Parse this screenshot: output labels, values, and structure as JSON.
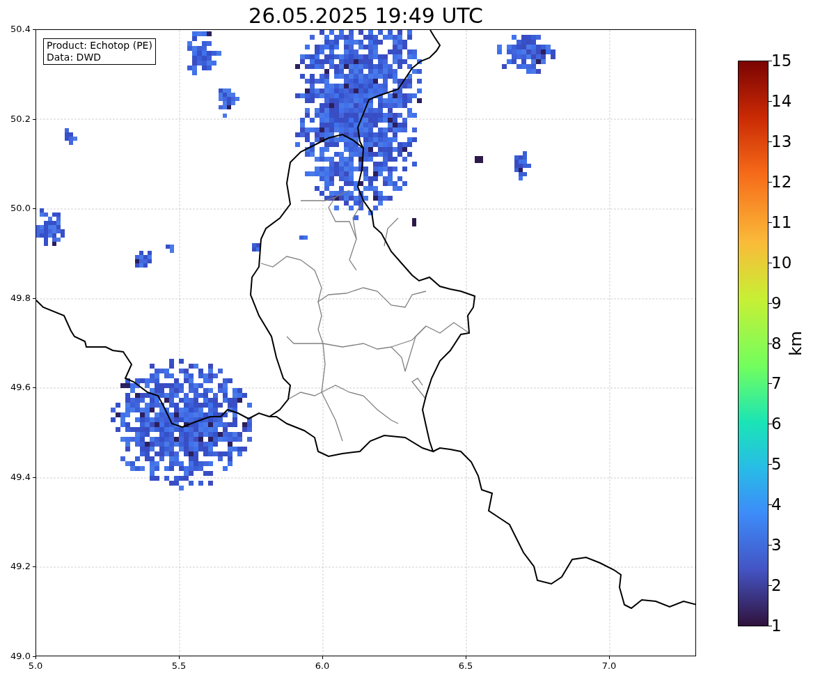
{
  "title": "26.05.2025 19:49 UTC",
  "info_box": [
    "Product: Echotop (PE)",
    "Data: DWD"
  ],
  "map": {
    "x_ticks": [
      "5.0",
      "5.5",
      "6.0",
      "6.5",
      "7.0"
    ],
    "y_ticks": [
      "50.4",
      "50.2",
      "50.0",
      "49.8",
      "49.6",
      "49.4",
      "49.2",
      "49.0"
    ]
  },
  "colorbar": {
    "label": "km",
    "ticks": [
      "15",
      "14",
      "13",
      "12",
      "11",
      "10",
      "9",
      "8",
      "7",
      "6",
      "5",
      "4",
      "3",
      "2",
      "1"
    ]
  }
}
